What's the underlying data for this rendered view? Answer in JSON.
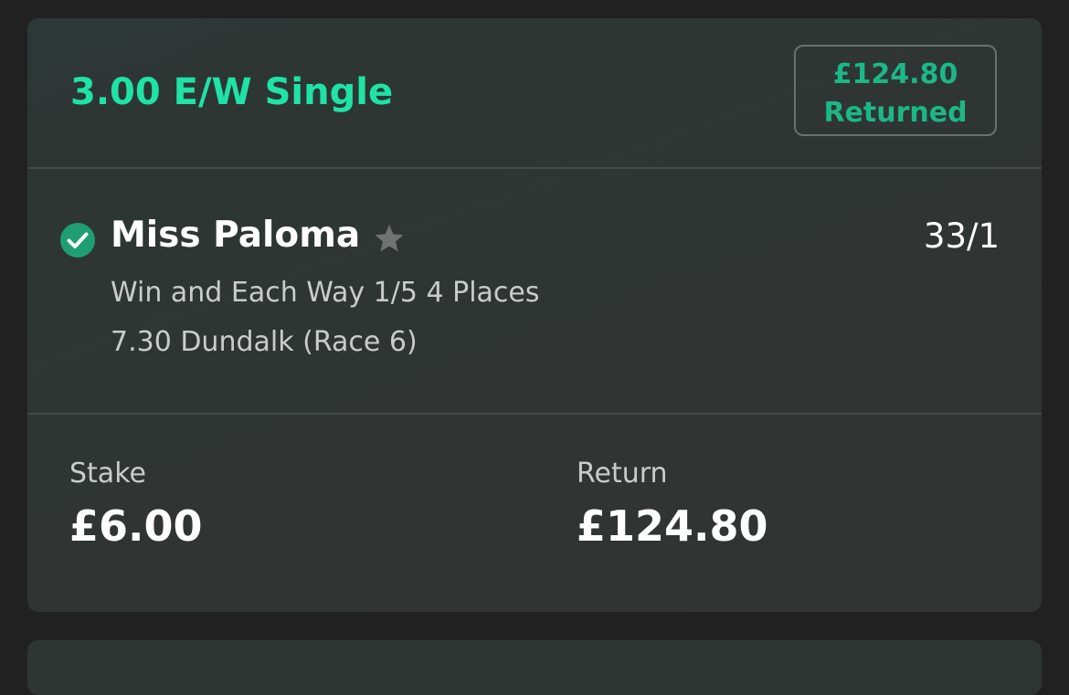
{
  "bet": {
    "title": "3.00 E/W Single",
    "status_amount": "£124.80",
    "status_label": "Returned"
  },
  "selection": {
    "name": "Miss Paloma",
    "odds": "33/1",
    "market": "Win and Each Way 1/5 4 Places",
    "event": "7.30 Dundalk (Race 6)",
    "result_icon": "check-circle-icon",
    "favourite_icon": "star-icon"
  },
  "totals": {
    "stake_label": "Stake",
    "stake_value": "£6.00",
    "return_label": "Return",
    "return_value": "£124.80"
  },
  "colors": {
    "accent": "#1fe3a6",
    "returned": "#1bb886",
    "check": "#1f9e73",
    "background": "#212121",
    "card": "#2f3533"
  }
}
